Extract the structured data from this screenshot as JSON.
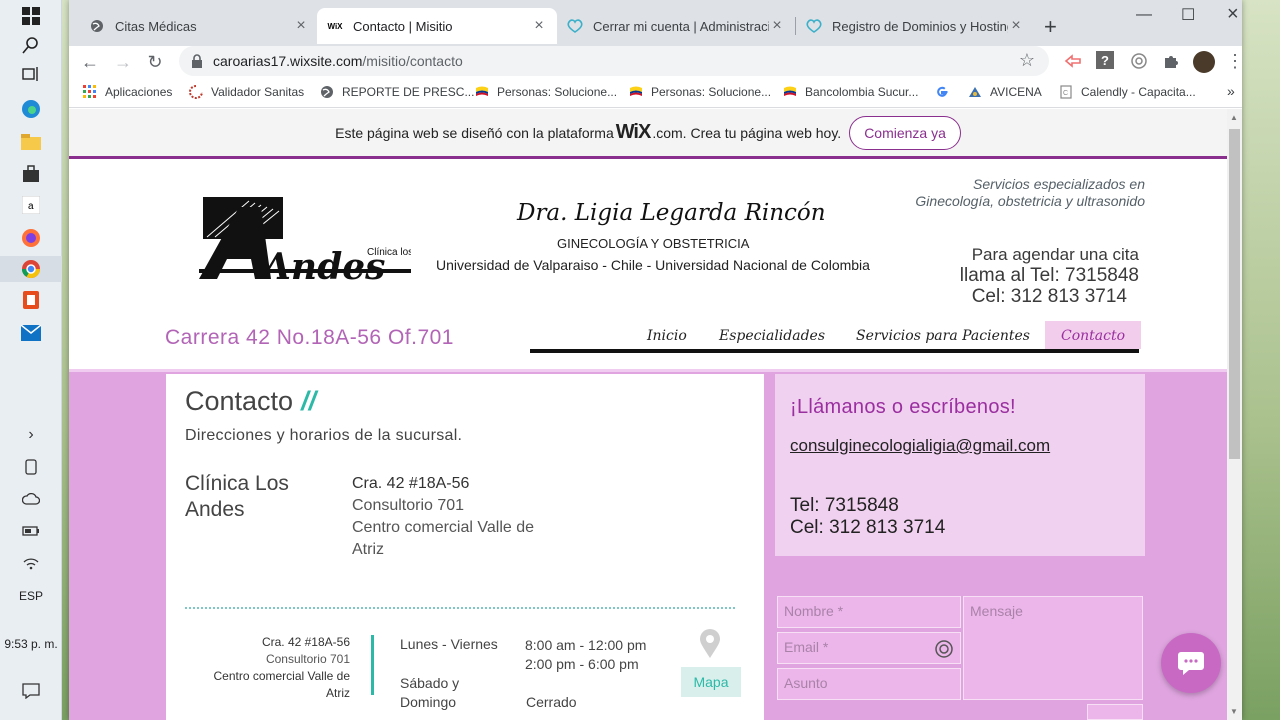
{
  "taskbar": {
    "lang": "ESP",
    "time": "9:53 p. m."
  },
  "browser": {
    "tabs": [
      {
        "title": "Citas Médicas",
        "active": false
      },
      {
        "title": "Contacto | Misitio",
        "active": true
      },
      {
        "title": "Cerrar mi cuenta | Administración",
        "active": false
      },
      {
        "title": "Registro de Dominios y Hosting en",
        "active": false
      }
    ],
    "url_host": "caroarias17.wixsite.com",
    "url_path": "/misitio/contacto",
    "bookmarks": [
      "Aplicaciones",
      "Validador Sanitas",
      "REPORTE DE PRESC...",
      "Personas: Solucione...",
      "Personas: Solucione...",
      "Bancolombia Sucur...",
      "",
      "AVICENA",
      "Calendly - Capacita..."
    ]
  },
  "wix_banner": {
    "text_before": "Este página web se diseñó con la plataforma",
    "brand": "WiX",
    "text_after": ".com. Crea tu página web hoy.",
    "cta": "Comienza ya"
  },
  "header": {
    "logo_small": "Clínica los",
    "logo_big": "Andes",
    "doctor_name": "Dra. Ligia Legarda Rincón",
    "specialty": "GINECOLOGÍA Y OBSTETRICIA",
    "universities": "Universidad de Valparaiso - Chile - Universidad Nacional de Colombia",
    "services_line1": "Servicios especializados en",
    "services_line2": "Ginecología, obstetricia y ultrasonido",
    "appt_line1": "Para agendar una cita",
    "appt_line2": "llama al Tel: 7315848",
    "appt_line3": "Cel: 312 813 3714",
    "address": "Carrera 42 No.18A-56 Of.701",
    "menu": [
      "Inicio",
      "Especialidades",
      "Servicios para Pacientes",
      "Contacto"
    ]
  },
  "contact_card": {
    "title": "Contacto",
    "slashes": "//",
    "subtitle": "Direcciones y horarios de la sucursal.",
    "branch_name_1": "Clínica Los",
    "branch_name_2": "Andes",
    "address_lines": [
      "Cra. 42 #18A-56",
      "Consultorio 701",
      "Centro comercial Valle de",
      "Atriz"
    ],
    "branch_address_lines": [
      "Cra. 42 #18A-56",
      "Consultorio 701",
      "Centro comercial Valle de",
      "Atriz"
    ],
    "hours": {
      "weekday_label": "Lunes -  Viernes",
      "weekday_am": "8:00 am - 12:00 pm",
      "weekday_pm": "2:00 pm - 6:00 pm",
      "weekend_label_1": "Sábado y",
      "weekend_label_2": "Domingo",
      "weekend_value": "Cerrado"
    },
    "map_button": "Mapa"
  },
  "call_box": {
    "heading": "¡Llámanos o escríbenos!",
    "email": "consulginecologialigia@gmail.com",
    "tel": "Tel: 7315848",
    "cel": "Cel: 312 813 3714"
  },
  "form": {
    "name_placeholder": "Nombre *",
    "email_placeholder": "Email *",
    "subject_placeholder": "Asunto",
    "message_placeholder": "Mensaje"
  },
  "colors": {
    "brand_purple": "#8b2f8f",
    "band_pink": "#e0a5e0",
    "teal": "#2cb9a8"
  }
}
